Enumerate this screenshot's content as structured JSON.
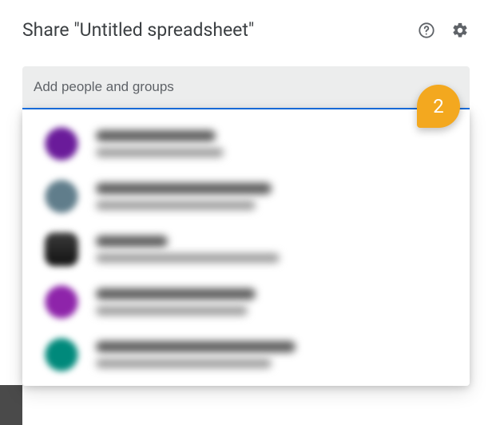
{
  "header": {
    "title": "Share \"Untitled spreadsheet\"",
    "help_icon": "help-circle-icon",
    "settings_icon": "gear-icon"
  },
  "input": {
    "placeholder": "Add people and groups",
    "value": ""
  },
  "callout": {
    "number": "2"
  },
  "suggestions": [
    {
      "avatar_color": "purple",
      "name_blur_w": 150,
      "email_blur_w": 160
    },
    {
      "avatar_color": "grey",
      "name_blur_w": 220,
      "email_blur_w": 200
    },
    {
      "avatar_color": "dark",
      "name_blur_w": 90,
      "email_blur_w": 230
    },
    {
      "avatar_color": "violet",
      "name_blur_w": 200,
      "email_blur_w": 190
    },
    {
      "avatar_color": "teal",
      "name_blur_w": 250,
      "email_blur_w": 220
    }
  ]
}
